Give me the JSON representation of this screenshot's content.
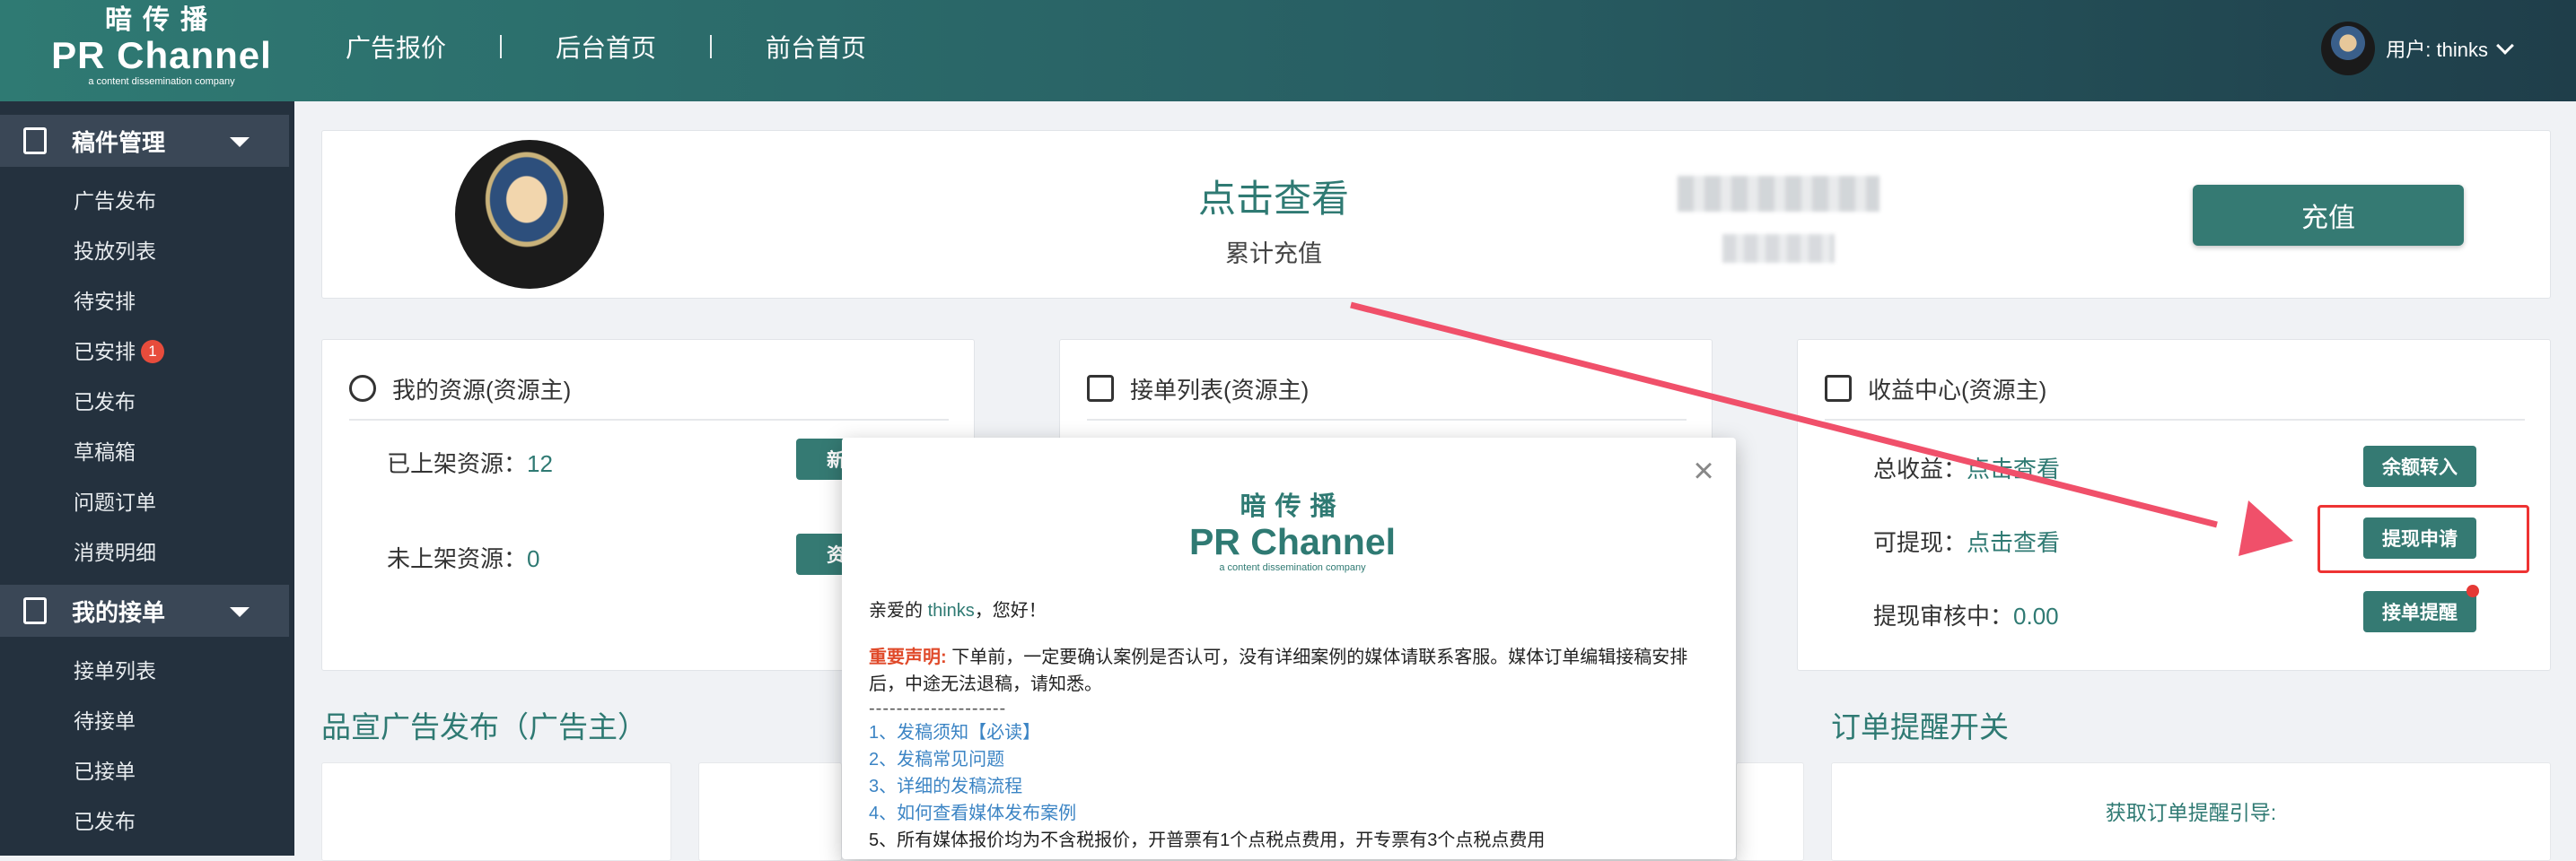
{
  "header": {
    "logo_cn": "暗传播",
    "logo_en": "PR Channel",
    "logo_sub": "a content dissemination company",
    "nav": [
      "广告报价",
      "后台首页",
      "前台首页"
    ],
    "user_label": "用户: thinks"
  },
  "sidebar": {
    "section1": {
      "title": "稿件管理",
      "items": [
        "广告发布",
        "投放列表",
        "待安排",
        "已安排",
        "已发布",
        "草稿箱",
        "问题订单",
        "消费明细"
      ],
      "badge_item_index": 3,
      "badge": "1"
    },
    "section2": {
      "title": "我的接单",
      "items": [
        "接单列表",
        "待接单",
        "已接单",
        "已发布"
      ]
    }
  },
  "summary": {
    "click_view": "点击查看",
    "label": "累计充值",
    "recharge_button": "充值"
  },
  "panels": {
    "resources": {
      "title": "我的资源(资源主)",
      "listed_label": "已上架资源：",
      "listed_value": "12",
      "unlisted_label": "未上架资源：",
      "unlisted_value": "0",
      "btn_new": "新增",
      "btn_res": "资源"
    },
    "orders": {
      "title": "接单列表(资源主)"
    },
    "income": {
      "title": "收益中心(资源主)",
      "total_label": "总收益：",
      "total_value": "点击查看",
      "withdrawable_label": "可提现：",
      "withdrawable_value": "点击查看",
      "pending_label": "提现审核中：",
      "pending_value": "0.00",
      "btn_transfer": "余额转入",
      "btn_withdraw": "提现申请",
      "btn_remind": "接单提醒"
    }
  },
  "sections": {
    "ad_publish": "品宣广告发布（广告主）",
    "order_remind": "订单提醒开关",
    "remind_guide": "获取订单提醒引导:"
  },
  "modal": {
    "close": "×",
    "logo_cn": "暗传播",
    "logo_en": "PR Channel",
    "logo_sub": "a content dissemination company",
    "greet_prefix": "亲爱的 ",
    "greet_name": "thinks",
    "greet_suffix": "，您好！",
    "warn_label": "重要声明:",
    "warn_text": "下单前，一定要确认案例是否认可，没有详细案例的媒体请联系客服。媒体订单编辑接稿安排后，中途无法退稿，请知悉。",
    "dashes": "--------------------",
    "links": [
      "1、发稿须知【必读】",
      "2、发稿常见问题",
      "3、详细的发稿流程",
      "4、如何查看媒体发布案例"
    ],
    "note": "5、所有媒体报价均为不含税报价，开普票有1个点税点费用，开专票有3个点税点费用"
  },
  "colors": {
    "brand": "#2f7a73",
    "sidebar_bg": "#24313e",
    "annotation_red": "#e33333"
  }
}
